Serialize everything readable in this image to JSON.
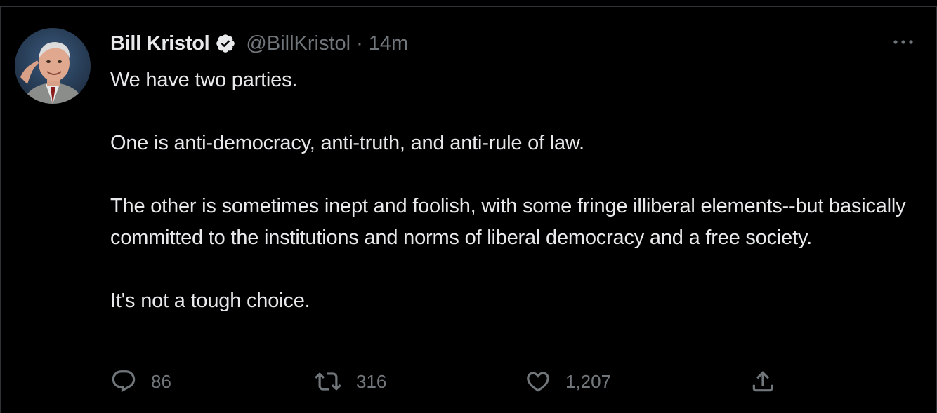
{
  "tweet": {
    "author": {
      "name": "Bill Kristol",
      "handle": "@BillKristol",
      "verified": true,
      "avatar": "profile-photo"
    },
    "separator": "·",
    "timestamp": "14m",
    "paragraphs": [
      "We have two parties.",
      "One is anti-democracy, anti-truth, and anti-rule of law.",
      "The other is sometimes inept and foolish, with some fringe illiberal elements--but basically committed to the institutions and norms of liberal democracy and a free society.",
      "It's not a tough choice."
    ],
    "stats": {
      "replies": "86",
      "retweets": "316",
      "likes": "1,207"
    },
    "icons": {
      "reply": "reply-icon",
      "retweet": "retweet-icon",
      "like": "heart-icon",
      "share": "share-icon",
      "more": "more-icon",
      "verified": "verified-badge-icon"
    }
  },
  "colors": {
    "background": "#000000",
    "text_primary": "#e7e9ea",
    "text_secondary": "#71767b",
    "border": "#2f3336"
  }
}
